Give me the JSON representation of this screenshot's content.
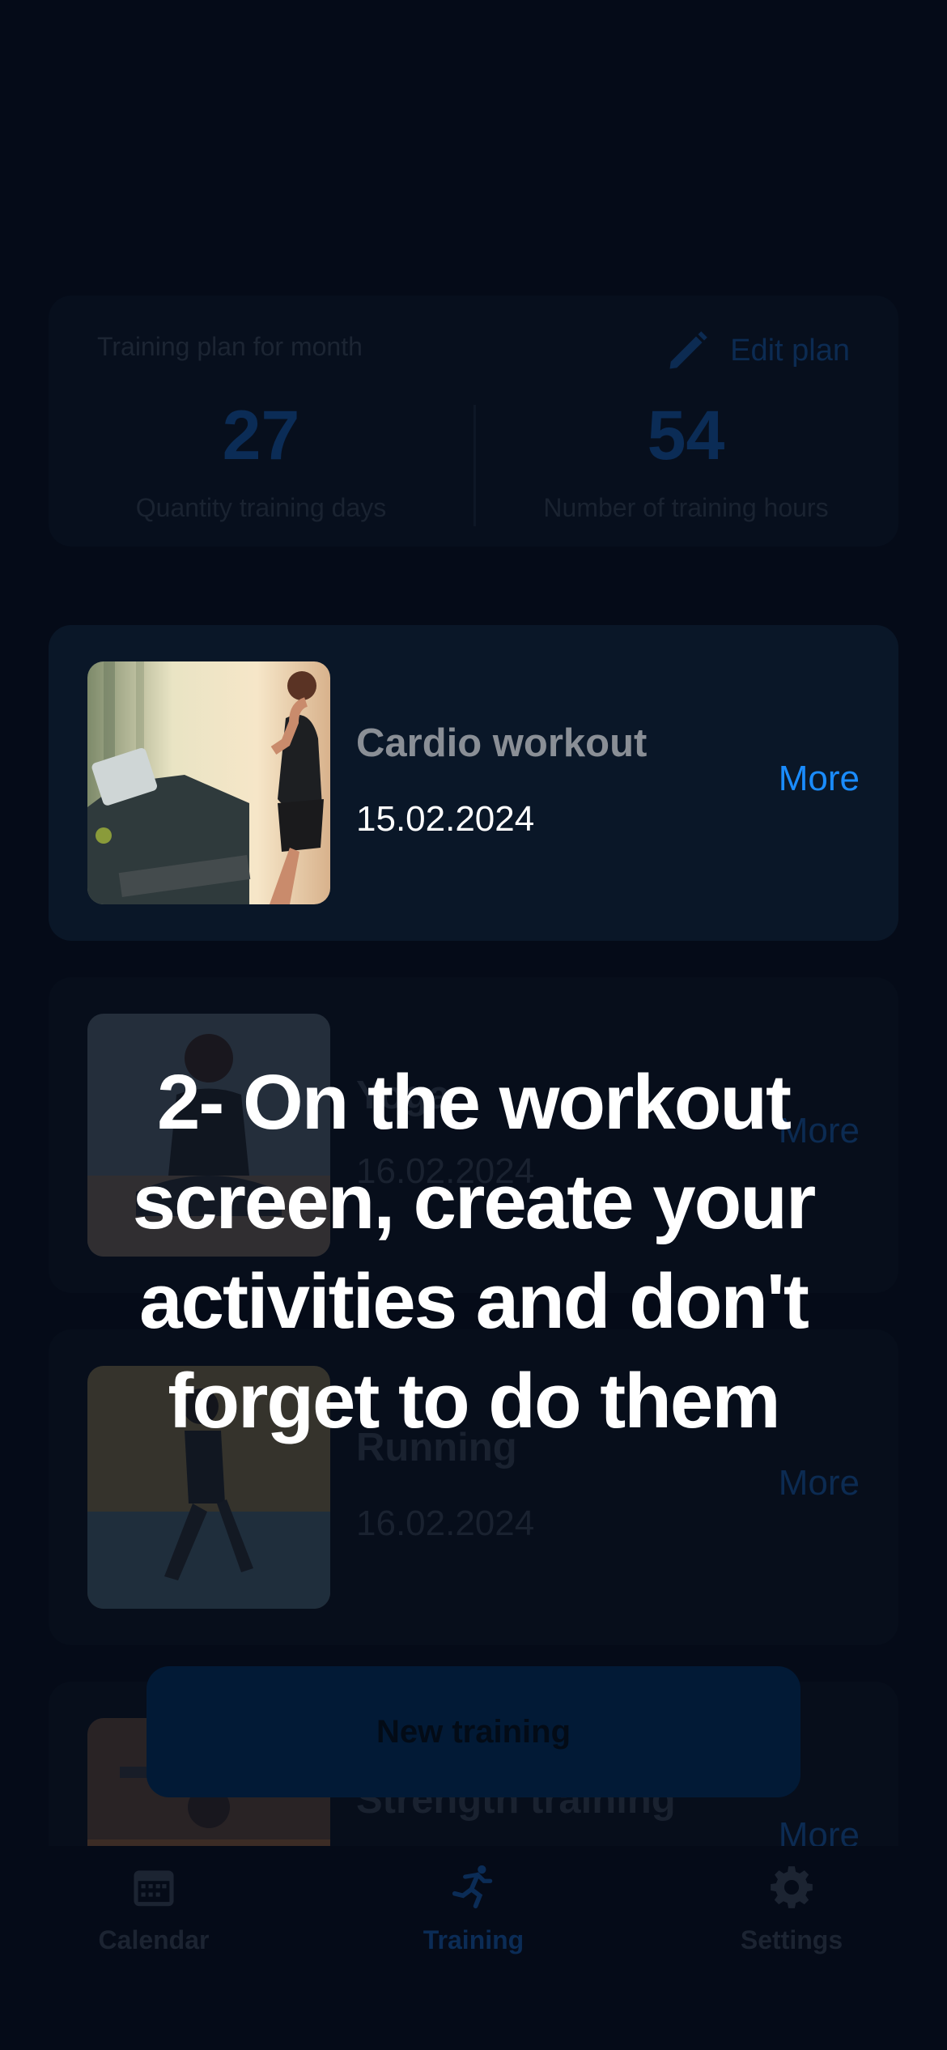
{
  "plan": {
    "title": "Training plan for month",
    "edit_label": "Edit plan",
    "days_value": "27",
    "days_label": "Quantity training days",
    "hours_value": "54",
    "hours_label": "Number of training hours"
  },
  "workouts": [
    {
      "name": "Cardio workout",
      "date": "15.02.2024",
      "more": "More"
    },
    {
      "name": "Yoga",
      "date": "16.02.2024",
      "more": "More"
    },
    {
      "name": "Running",
      "date": "16.02.2024",
      "more": "More"
    },
    {
      "name": "Strength training",
      "date": "",
      "more": "More"
    }
  ],
  "new_training": "New training",
  "tabs": [
    {
      "label": "Calendar",
      "icon": "calendar-icon"
    },
    {
      "label": "Training",
      "icon": "runner-icon"
    },
    {
      "label": "Settings",
      "icon": "gear-icon"
    }
  ],
  "caption": "2- On the workout screen, create your activities and don't forget to do them",
  "colors": {
    "background": "#050b18",
    "accent": "#1a8cff"
  }
}
